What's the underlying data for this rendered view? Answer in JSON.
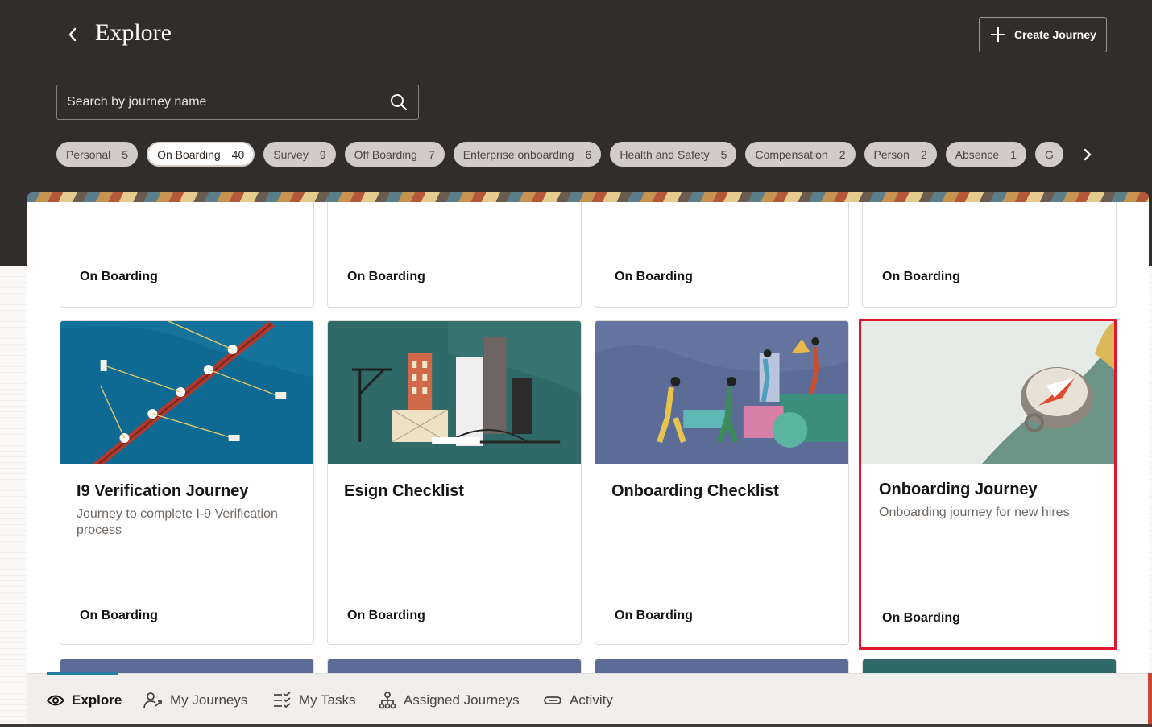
{
  "header": {
    "title": "Explore",
    "create_button": "Create Journey",
    "search_placeholder": "Search by journey name"
  },
  "chips": [
    {
      "label": "Personal",
      "count": "5",
      "selected": false
    },
    {
      "label": "On Boarding",
      "count": "40",
      "selected": true
    },
    {
      "label": "Survey",
      "count": "9",
      "selected": false
    },
    {
      "label": "Off Boarding",
      "count": "7",
      "selected": false
    },
    {
      "label": "Enterprise onboarding",
      "count": "6",
      "selected": false
    },
    {
      "label": "Health and Safety",
      "count": "5",
      "selected": false
    },
    {
      "label": "Compensation",
      "count": "2",
      "selected": false
    },
    {
      "label": "Person",
      "count": "2",
      "selected": false
    },
    {
      "label": "Absence",
      "count": "1",
      "selected": false
    },
    {
      "label": "G",
      "count": "",
      "selected": false
    }
  ],
  "top_cards": [
    {
      "category": "On Boarding"
    },
    {
      "category": "On Boarding"
    },
    {
      "category": "On Boarding"
    },
    {
      "category": "On Boarding"
    }
  ],
  "cards": [
    {
      "title": "I9 Verification Journey",
      "description": "Journey to complete I-9 Verification process",
      "category": "On Boarding",
      "image": "rowing-boat-illustration"
    },
    {
      "title": "Esign Checklist",
      "description": "",
      "category": "On Boarding",
      "image": "city-skyline-illustration"
    },
    {
      "title": "Onboarding  Checklist",
      "description": "",
      "category": "On Boarding",
      "image": "team-building-illustration"
    },
    {
      "title": "Onboarding Journey",
      "description": "Onboarding journey for new hires",
      "category": "On Boarding",
      "image": "compass-illustration"
    }
  ],
  "nav": [
    {
      "label": "Explore",
      "icon": "eye-icon",
      "active": true
    },
    {
      "label": "My Journeys",
      "icon": "person-route-icon",
      "active": false
    },
    {
      "label": "My Tasks",
      "icon": "checklist-icon",
      "active": false
    },
    {
      "label": "Assigned Journeys",
      "icon": "org-chart-icon",
      "active": false
    },
    {
      "label": "Activity",
      "icon": "link-icon",
      "active": false
    }
  ],
  "colors": {
    "header_bg": "#312d2a",
    "accent": "#227e9e",
    "highlight": "#e0182d"
  }
}
